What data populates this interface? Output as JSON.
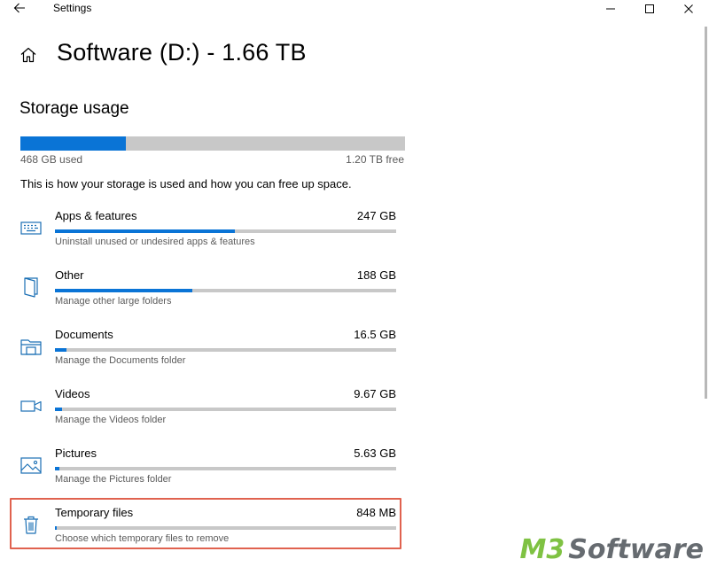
{
  "window": {
    "app_title": "Settings"
  },
  "header": {
    "title": "Software (D:) - 1.66 TB"
  },
  "storage": {
    "section_title": "Storage usage",
    "used_label": "468 GB used",
    "free_label": "1.20 TB free",
    "used_fraction": 0.275,
    "description": "This is how your storage is used and how you can free up space."
  },
  "categories": [
    {
      "name": "Apps & features",
      "size": "247 GB",
      "subtitle": "Uninstall unused or undesired apps & features",
      "fraction": 0.528,
      "icon": "keyboard-icon"
    },
    {
      "name": "Other",
      "size": "188 GB",
      "subtitle": "Manage other large folders",
      "fraction": 0.402,
      "icon": "folder-book-icon"
    },
    {
      "name": "Documents",
      "size": "16.5 GB",
      "subtitle": "Manage the Documents folder",
      "fraction": 0.035,
      "icon": "documents-folder-icon"
    },
    {
      "name": "Videos",
      "size": "9.67 GB",
      "subtitle": "Manage the Videos folder",
      "fraction": 0.021,
      "icon": "video-camera-icon"
    },
    {
      "name": "Pictures",
      "size": "5.63 GB",
      "subtitle": "Manage the Pictures folder",
      "fraction": 0.012,
      "icon": "picture-icon"
    },
    {
      "name": "Temporary files",
      "size": "848 MB",
      "subtitle": "Choose which temporary files to remove",
      "fraction": 0.002,
      "icon": "trash-icon"
    }
  ],
  "colors": {
    "accent": "#0a74d6",
    "track": "#c8c8c8",
    "highlight": "#e0624f"
  },
  "watermark": {
    "brand_a": "M3",
    "brand_b": "Software"
  }
}
